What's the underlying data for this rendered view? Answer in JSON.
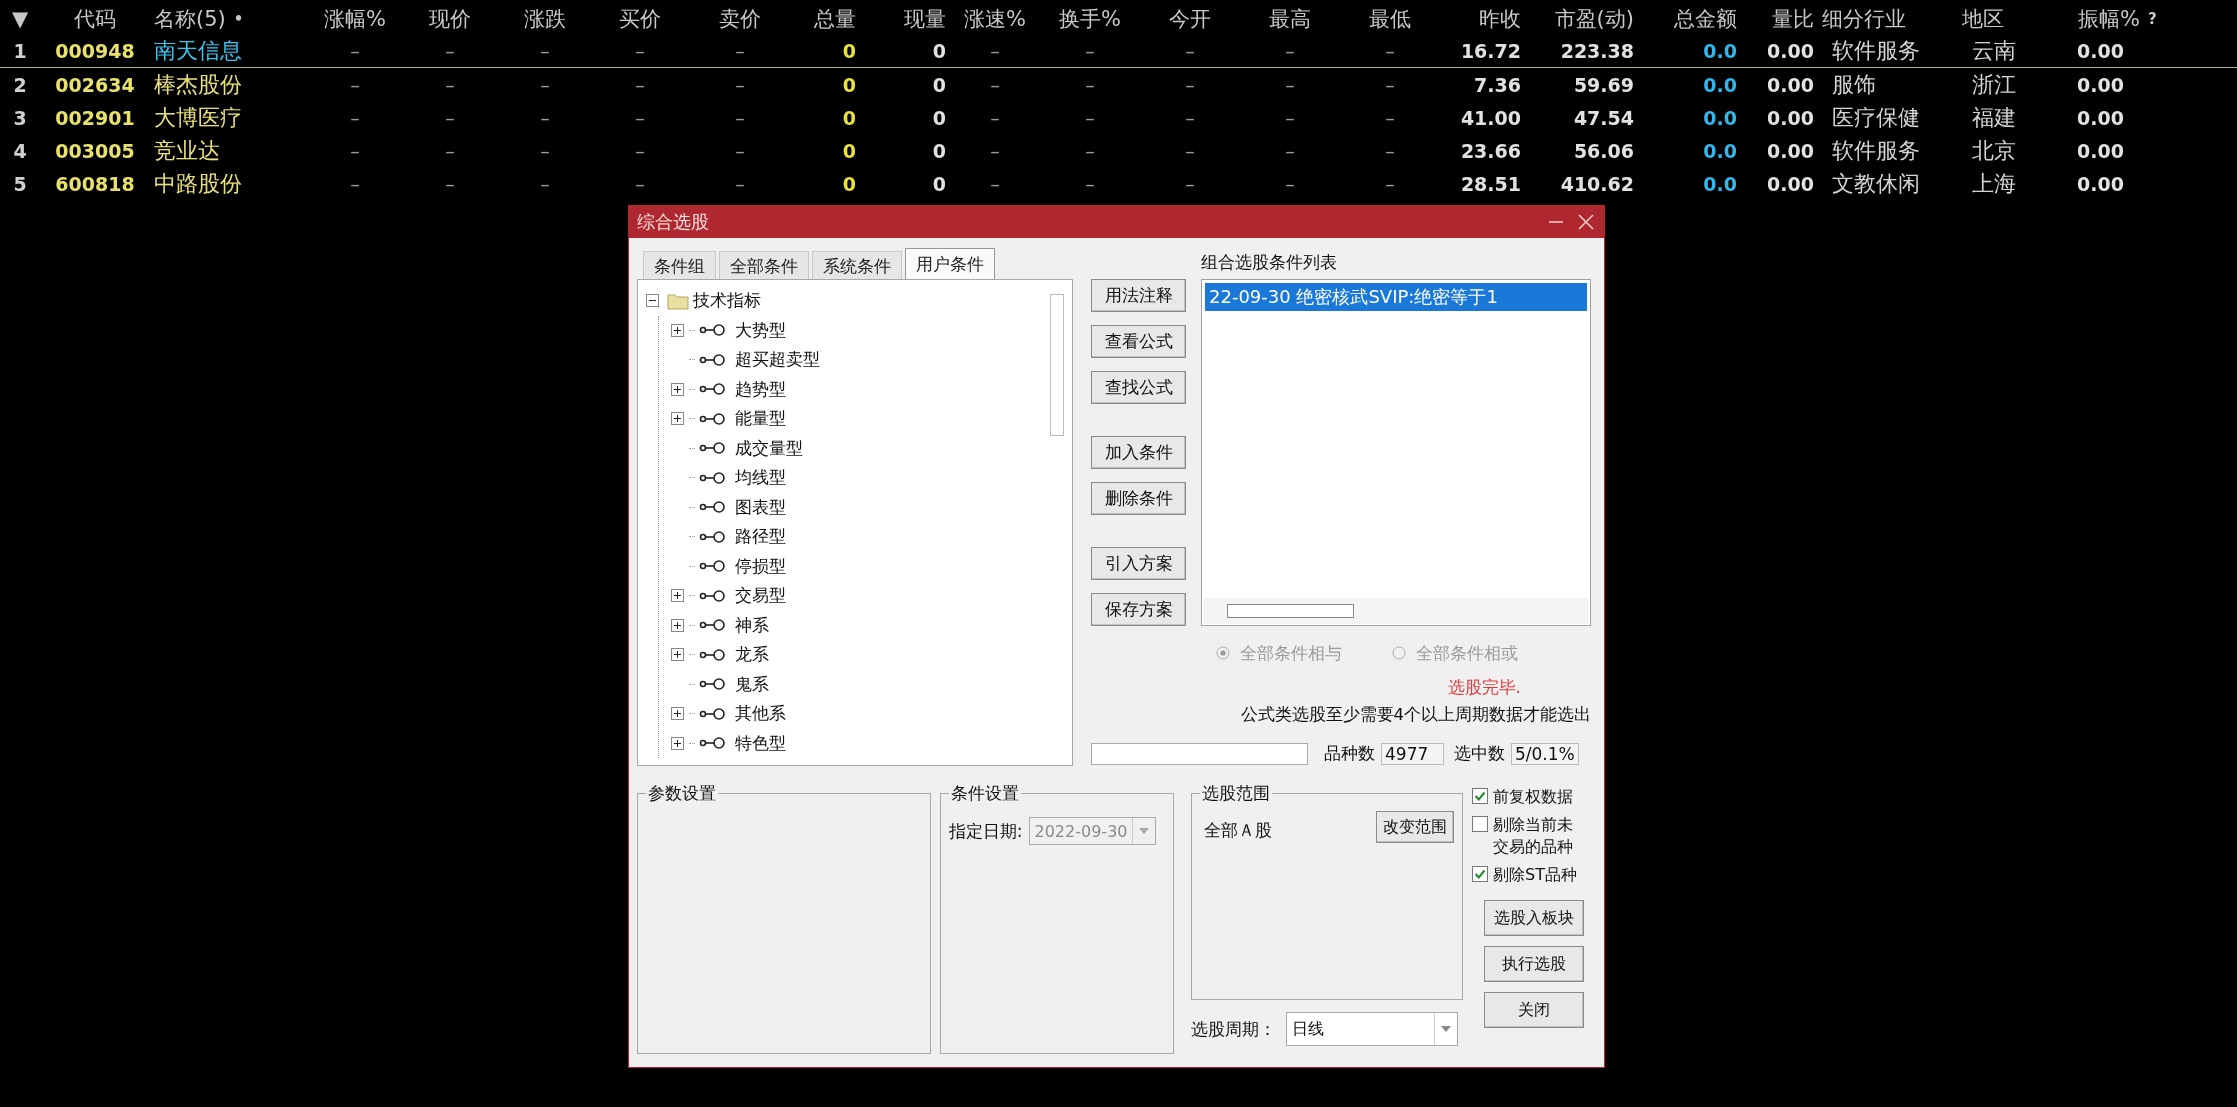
{
  "table": {
    "columns": [
      {
        "label": "▼",
        "kind": "index"
      },
      {
        "label": "代码",
        "kind": "code"
      },
      {
        "label": "名称(5)",
        "suffix": "•",
        "kind": "name"
      },
      {
        "label": "涨幅%",
        "kind": "dash"
      },
      {
        "label": "现价",
        "kind": "dash"
      },
      {
        "label": "涨跌",
        "kind": "dash"
      },
      {
        "label": "买价",
        "kind": "dash"
      },
      {
        "label": "卖价",
        "kind": "dash"
      },
      {
        "label": "总量",
        "kind": "volume"
      },
      {
        "label": "现量",
        "kind": "number"
      },
      {
        "label": "涨速%",
        "kind": "dash"
      },
      {
        "label": "换手%",
        "kind": "dash"
      },
      {
        "label": "今开",
        "kind": "dash"
      },
      {
        "label": "最高",
        "kind": "dash"
      },
      {
        "label": "最低",
        "kind": "dash"
      },
      {
        "label": "昨收",
        "kind": "number"
      },
      {
        "label": "市盈(动)",
        "kind": "number"
      },
      {
        "label": "总金额",
        "kind": "amount"
      },
      {
        "label": "量比",
        "kind": "number"
      },
      {
        "label": "细分行业",
        "kind": "text"
      },
      {
        "label": "地区",
        "kind": "text"
      },
      {
        "label": "振幅%",
        "suffix": "?",
        "kind": "number"
      }
    ],
    "rows": [
      {
        "selected": true,
        "cells": [
          "1",
          "000948",
          "南天信息",
          "–",
          "–",
          "–",
          "–",
          "–",
          "0",
          "0",
          "–",
          "–",
          "–",
          "–",
          "–",
          "16.72",
          "223.38",
          "0.0",
          "0.00",
          "软件服务",
          "云南",
          "0.00"
        ]
      },
      {
        "selected": false,
        "cells": [
          "2",
          "002634",
          "棒杰股份",
          "–",
          "–",
          "–",
          "–",
          "–",
          "0",
          "0",
          "–",
          "–",
          "–",
          "–",
          "–",
          "7.36",
          "59.69",
          "0.0",
          "0.00",
          "服饰",
          "浙江",
          "0.00"
        ]
      },
      {
        "selected": false,
        "cells": [
          "3",
          "002901",
          "大博医疗",
          "–",
          "–",
          "–",
          "–",
          "–",
          "0",
          "0",
          "–",
          "–",
          "–",
          "–",
          "–",
          "41.00",
          "47.54",
          "0.0",
          "0.00",
          "医疗保健",
          "福建",
          "0.00"
        ]
      },
      {
        "selected": false,
        "cells": [
          "4",
          "003005",
          "竞业达",
          "–",
          "–",
          "–",
          "–",
          "–",
          "0",
          "0",
          "–",
          "–",
          "–",
          "–",
          "–",
          "23.66",
          "56.06",
          "0.0",
          "0.00",
          "软件服务",
          "北京",
          "0.00"
        ]
      },
      {
        "selected": false,
        "cells": [
          "5",
          "600818",
          "中路股份",
          "–",
          "–",
          "–",
          "–",
          "–",
          "0",
          "0",
          "–",
          "–",
          "–",
          "–",
          "–",
          "28.51",
          "410.62",
          "0.0",
          "0.00",
          "文教休闲",
          "上海",
          "0.00"
        ]
      }
    ]
  },
  "dialog": {
    "title": "综合选股",
    "tabs": [
      {
        "label": "条件组",
        "selected": false
      },
      {
        "label": "全部条件",
        "selected": false
      },
      {
        "label": "系统条件",
        "selected": false
      },
      {
        "label": "用户条件",
        "selected": true
      }
    ],
    "tree": [
      {
        "label": "技术指标",
        "expanded": true,
        "children": [
          {
            "label": "大势型",
            "expandable": true
          },
          {
            "label": "超买超卖型",
            "expandable": false
          },
          {
            "label": "趋势型",
            "expandable": true
          },
          {
            "label": "能量型",
            "expandable": true
          },
          {
            "label": "成交量型",
            "expandable": false
          },
          {
            "label": "均线型",
            "expandable": false
          },
          {
            "label": "图表型",
            "expandable": false
          },
          {
            "label": "路径型",
            "expandable": false
          },
          {
            "label": "停损型",
            "expandable": false
          },
          {
            "label": "交易型",
            "expandable": true
          },
          {
            "label": "神系",
            "expandable": true
          },
          {
            "label": "龙系",
            "expandable": true
          },
          {
            "label": "鬼系",
            "expandable": false
          },
          {
            "label": "其他系",
            "expandable": true
          },
          {
            "label": "特色型",
            "expandable": true
          }
        ]
      }
    ],
    "action_button_groups": [
      [
        "用法注释",
        "查看公式",
        "查找公式"
      ],
      [
        "加入条件",
        "删除条件"
      ],
      [
        "引入方案",
        "保存方案"
      ]
    ],
    "condition_list": {
      "label": "组合选股条件列表",
      "items": [
        {
          "text": "22-09-30 绝密核武SVIP:绝密等于1",
          "selected": true
        }
      ]
    },
    "combine_mode": {
      "disabled": true,
      "options": [
        {
          "label": "全部条件相与",
          "selected": true
        },
        {
          "label": "全部条件相或",
          "selected": false
        }
      ]
    },
    "status": "选股完毕.",
    "note": "公式类选股至少需要4个以上周期数据才能选出",
    "progress": {
      "level": 0
    },
    "counts": [
      {
        "label": "品种数",
        "value": "4977"
      },
      {
        "label": "选中数",
        "value": "5/0.1%"
      }
    ],
    "param_group": {
      "title": "参数设置"
    },
    "condition_group": {
      "title": "条件设置",
      "date_label": "指定日期:",
      "date_value": "2022-09-30",
      "disabled": true
    },
    "scope_group": {
      "title": "选股范围",
      "scope": "全部Ａ股",
      "button": "改变范围"
    },
    "period": {
      "label": "选股周期：",
      "value": "日线"
    },
    "options": [
      {
        "label": "前复权数据",
        "checked": true
      },
      {
        "label": "剔除当前未交易的品种",
        "checked": false
      },
      {
        "label": "剔除ST品种",
        "checked": true
      }
    ],
    "side_buttons": [
      "选股入板块",
      "执行选股",
      "关闭"
    ]
  }
}
